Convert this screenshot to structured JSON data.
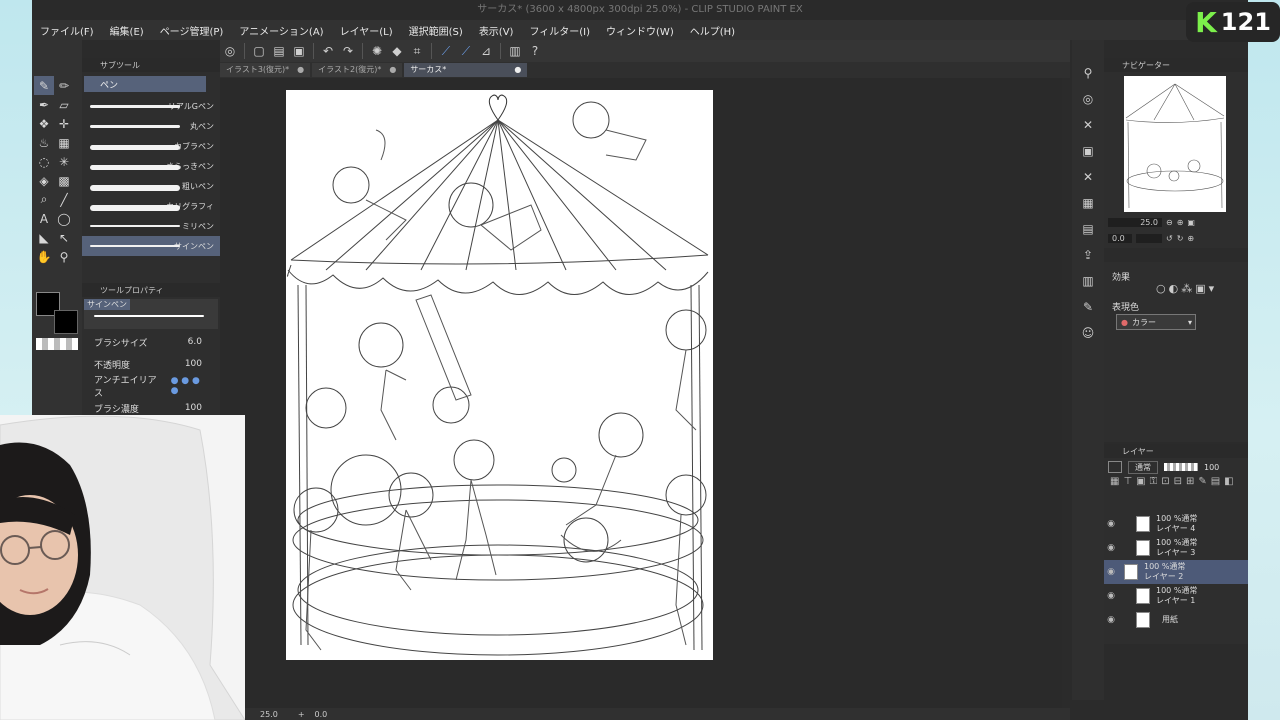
{
  "app": {
    "window_title": "サーカス* (3600 x 4800px 300dpi 25.0%)  - CLIP STUDIO PAINT EX"
  },
  "menu": [
    "ファイル(F)",
    "編集(E)",
    "ページ管理(P)",
    "アニメーション(A)",
    "レイヤー(L)",
    "選択範囲(S)",
    "表示(V)",
    "フィルター(I)",
    "ウィンドウ(W)",
    "ヘルプ(H)"
  ],
  "tabs": [
    {
      "label": "イラスト3(復元)*",
      "active": false
    },
    {
      "label": "イラスト2(復元)*",
      "active": false
    },
    {
      "label": "サーカス*",
      "active": true
    }
  ],
  "subtool": {
    "header": "サブツール",
    "group": "ペン",
    "brushes": [
      "リアルGペン",
      "丸ペン",
      "カブラペン",
      "さらっきペン",
      "粗いペン",
      "カリグラフィ",
      "ミリペン",
      "サインペン"
    ],
    "selected_brush": "サインペン"
  },
  "tool_property": {
    "header": "ツールプロパティ",
    "brush_name": "サインペン",
    "brush_size_label": "ブラシサイズ",
    "brush_size_value": "6.0",
    "opacity_label": "不透明度",
    "opacity_value": "100",
    "antialias_label": "アンチエイリアス",
    "density_label": "ブラシ濃度",
    "density_value": "100"
  },
  "navigator": {
    "header": "ナビゲーター",
    "zoom": "25.0",
    "rotate": "0.0"
  },
  "effects": {
    "label": "効果",
    "expression_label": "表現色",
    "expression_value": "カラー"
  },
  "layers": {
    "header": "レイヤー",
    "blend_mode": "通常",
    "opacity": "100",
    "items": [
      {
        "percent": "100 %通常",
        "name": "レイヤー 4",
        "selected": false
      },
      {
        "percent": "100 %通常",
        "name": "レイヤー 3",
        "selected": false
      },
      {
        "percent": "100 %通常",
        "name": "レイヤー 2",
        "selected": true
      },
      {
        "percent": "100 %通常",
        "name": "レイヤー 1",
        "selected": false
      },
      {
        "percent": "",
        "name": "用紙",
        "selected": false
      }
    ]
  },
  "status": {
    "zoom": "25.0",
    "rotate": "0.0"
  },
  "logo": {
    "letter": "K",
    "number": "121",
    "accent": "#7cf04b"
  }
}
